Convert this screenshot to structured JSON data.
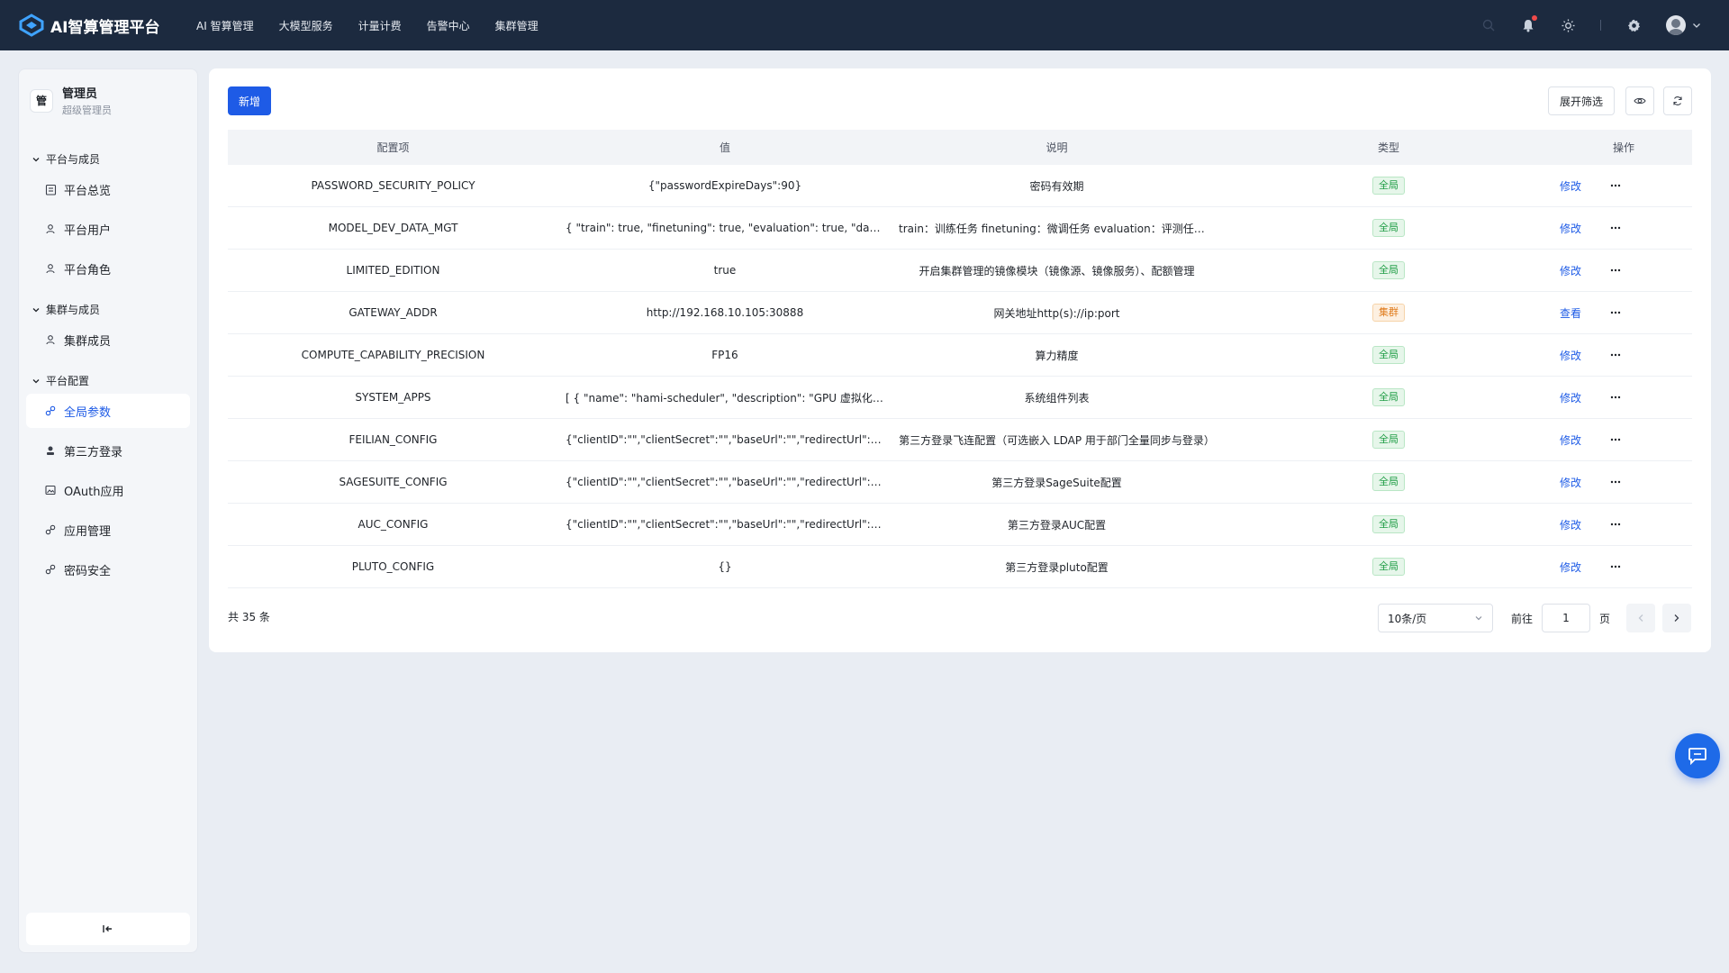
{
  "header": {
    "title": "AI智算管理平台",
    "nav": [
      "AI 智算管理",
      "大模型服务",
      "计量计费",
      "告警中心",
      "集群管理"
    ]
  },
  "sidebar": {
    "user": {
      "badge": "管",
      "name": "管理员",
      "role": "超级管理员"
    },
    "groups": [
      {
        "title": "平台与成员",
        "items": [
          {
            "label": "平台总览",
            "icon": "clipboard-icon"
          },
          {
            "label": "平台用户",
            "icon": "user-icon"
          },
          {
            "label": "平台角色",
            "icon": "user-role-icon"
          }
        ]
      },
      {
        "title": "集群与成员",
        "items": [
          {
            "label": "集群成员",
            "icon": "user-icon"
          }
        ]
      },
      {
        "title": "平台配置",
        "items": [
          {
            "label": "全局参数",
            "icon": "link-icon",
            "active": true
          },
          {
            "label": "第三方登录",
            "icon": "contact-icon"
          },
          {
            "label": "OAuth应用",
            "icon": "image-icon"
          },
          {
            "label": "应用管理",
            "icon": "link-icon"
          },
          {
            "label": "密码安全",
            "icon": "link-icon"
          }
        ]
      }
    ]
  },
  "toolbar": {
    "add_label": "新增",
    "filter_label": "展开筛选"
  },
  "table": {
    "columns": [
      "配置项",
      "值",
      "说明",
      "类型",
      "操作"
    ],
    "rows": [
      {
        "key": "PASSWORD_SECURITY_POLICY",
        "value": "{\"passwordExpireDays\":90}",
        "desc": "密码有效期",
        "type": "全局",
        "type_kind": "global",
        "action": "修改"
      },
      {
        "key": "MODEL_DEV_DATA_MGT",
        "value": "{ \"train\": true, \"finetuning\": true, \"evaluation\": true, \"dataset\": true }",
        "desc": "train：训练任务 finetuning：微调任务 evaluation：评测任务 dataset：数据集",
        "type": "全局",
        "type_kind": "global",
        "action": "修改"
      },
      {
        "key": "LIMITED_EDITION",
        "value": "true",
        "desc": "开启集群管理的镜像模块（镜像源、镜像服务）、配额管理",
        "type": "全局",
        "type_kind": "global",
        "action": "修改"
      },
      {
        "key": "GATEWAY_ADDR",
        "value": "http://192.168.10.105:30888",
        "desc": "网关地址http(s)://ip:port",
        "type": "集群",
        "type_kind": "cluster",
        "action": "查看"
      },
      {
        "key": "COMPUTE_CAPABILITY_PRECISION",
        "value": "FP16",
        "desc": "算力精度",
        "type": "全局",
        "type_kind": "global",
        "action": "修改"
      },
      {
        "key": "SYSTEM_APPS",
        "value": "[ { \"name\": \"hami-scheduler\", \"description\": \"GPU 虚拟化的调度器\" } ]",
        "desc": "系统组件列表",
        "type": "全局",
        "type_kind": "global",
        "action": "修改"
      },
      {
        "key": "FEILIAN_CONFIG",
        "value": "{\"clientID\":\"\",\"clientSecret\":\"\",\"baseUrl\":\"\",\"redirectUrl\":\"\",\"isDeptSync\":false}",
        "desc": "第三方登录飞连配置（可选嵌入 LDAP 用于部门全量同步与登录）",
        "type": "全局",
        "type_kind": "global",
        "action": "修改"
      },
      {
        "key": "SAGESUITE_CONFIG",
        "value": "{\"clientID\":\"\",\"clientSecret\":\"\",\"baseUrl\":\"\",\"redirectUrl\":\"\"}",
        "desc": "第三方登录SageSuite配置",
        "type": "全局",
        "type_kind": "global",
        "action": "修改"
      },
      {
        "key": "AUC_CONFIG",
        "value": "{\"clientID\":\"\",\"clientSecret\":\"\",\"baseUrl\":\"\",\"redirectUrl\":\"\"}",
        "desc": "第三方登录AUC配置",
        "type": "全局",
        "type_kind": "global",
        "action": "修改"
      },
      {
        "key": "PLUTO_CONFIG",
        "value": "{}",
        "desc": "第三方登录pluto配置",
        "type": "全局",
        "type_kind": "global",
        "action": "修改"
      }
    ]
  },
  "pagination": {
    "total_text": "共 35 条",
    "page_size": "10条/页",
    "goto_label": "前往",
    "current_page": "1",
    "page_unit": "页"
  },
  "colors": {
    "primary": "#1e5be6",
    "header_bg": "#1c2a3f",
    "global_tag": "#1f9d45",
    "cluster_tag": "#e07b1c"
  }
}
